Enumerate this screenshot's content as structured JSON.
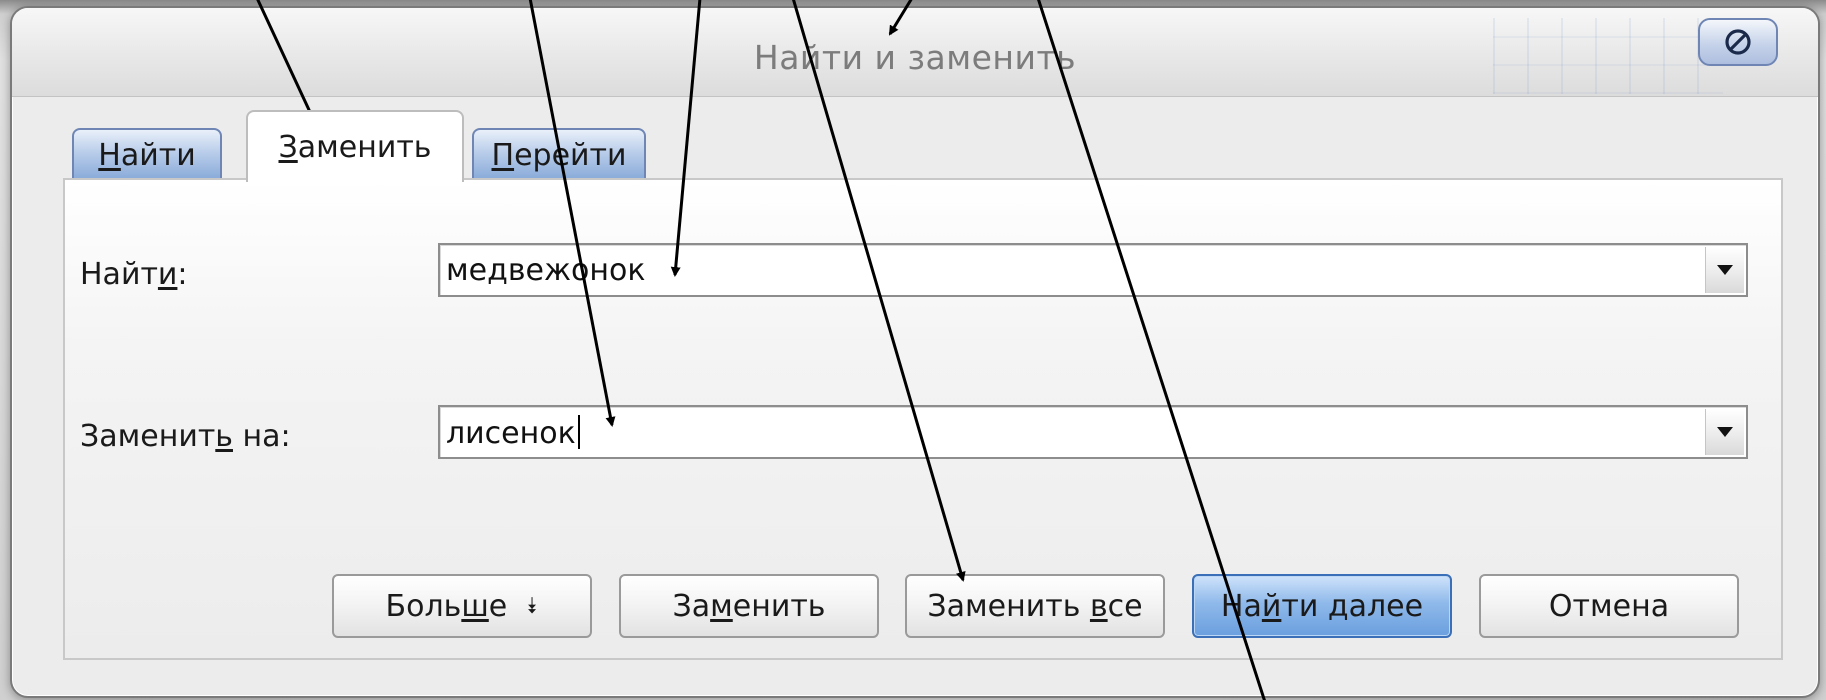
{
  "dialog": {
    "title": "Найти и заменить",
    "close_icon": "no-entry-icon"
  },
  "tabs": [
    {
      "key": "find",
      "prefix": "",
      "underline": "Н",
      "suffix": "айти",
      "active": false
    },
    {
      "key": "replace",
      "prefix": "",
      "underline": "З",
      "suffix": "аменить",
      "active": true
    },
    {
      "key": "goto",
      "prefix": "",
      "underline": "П",
      "suffix": "ерейти",
      "active": false
    }
  ],
  "find": {
    "label_prefix": "Найт",
    "label_underline": "и",
    "label_suffix": ":",
    "value": "медвежонок",
    "dropdown_icon": "chevron-down-icon"
  },
  "replace": {
    "label_prefix": "Заменит",
    "label_underline": "ь",
    "label_suffix": " на:",
    "value": "лисенок",
    "dropdown_icon": "chevron-down-icon"
  },
  "buttons": {
    "more": {
      "prefix": "Боль",
      "underline": "ш",
      "suffix": "е",
      "icon": "double-chevron-down-icon",
      "icon_glyph": "⯯"
    },
    "replace": {
      "prefix": "За",
      "underline": "м",
      "suffix": "енить"
    },
    "replace_all": {
      "prefix": "Заменить ",
      "underline": "в",
      "suffix": "се"
    },
    "find_next": {
      "prefix": "На",
      "underline": "й",
      "suffix": "ти далее"
    },
    "cancel": {
      "label": "Отмена"
    }
  },
  "colors": {
    "accent_blue": "#6a9fde",
    "tab_blue": "#87a9d8",
    "dialog_bg": "#ececec"
  }
}
